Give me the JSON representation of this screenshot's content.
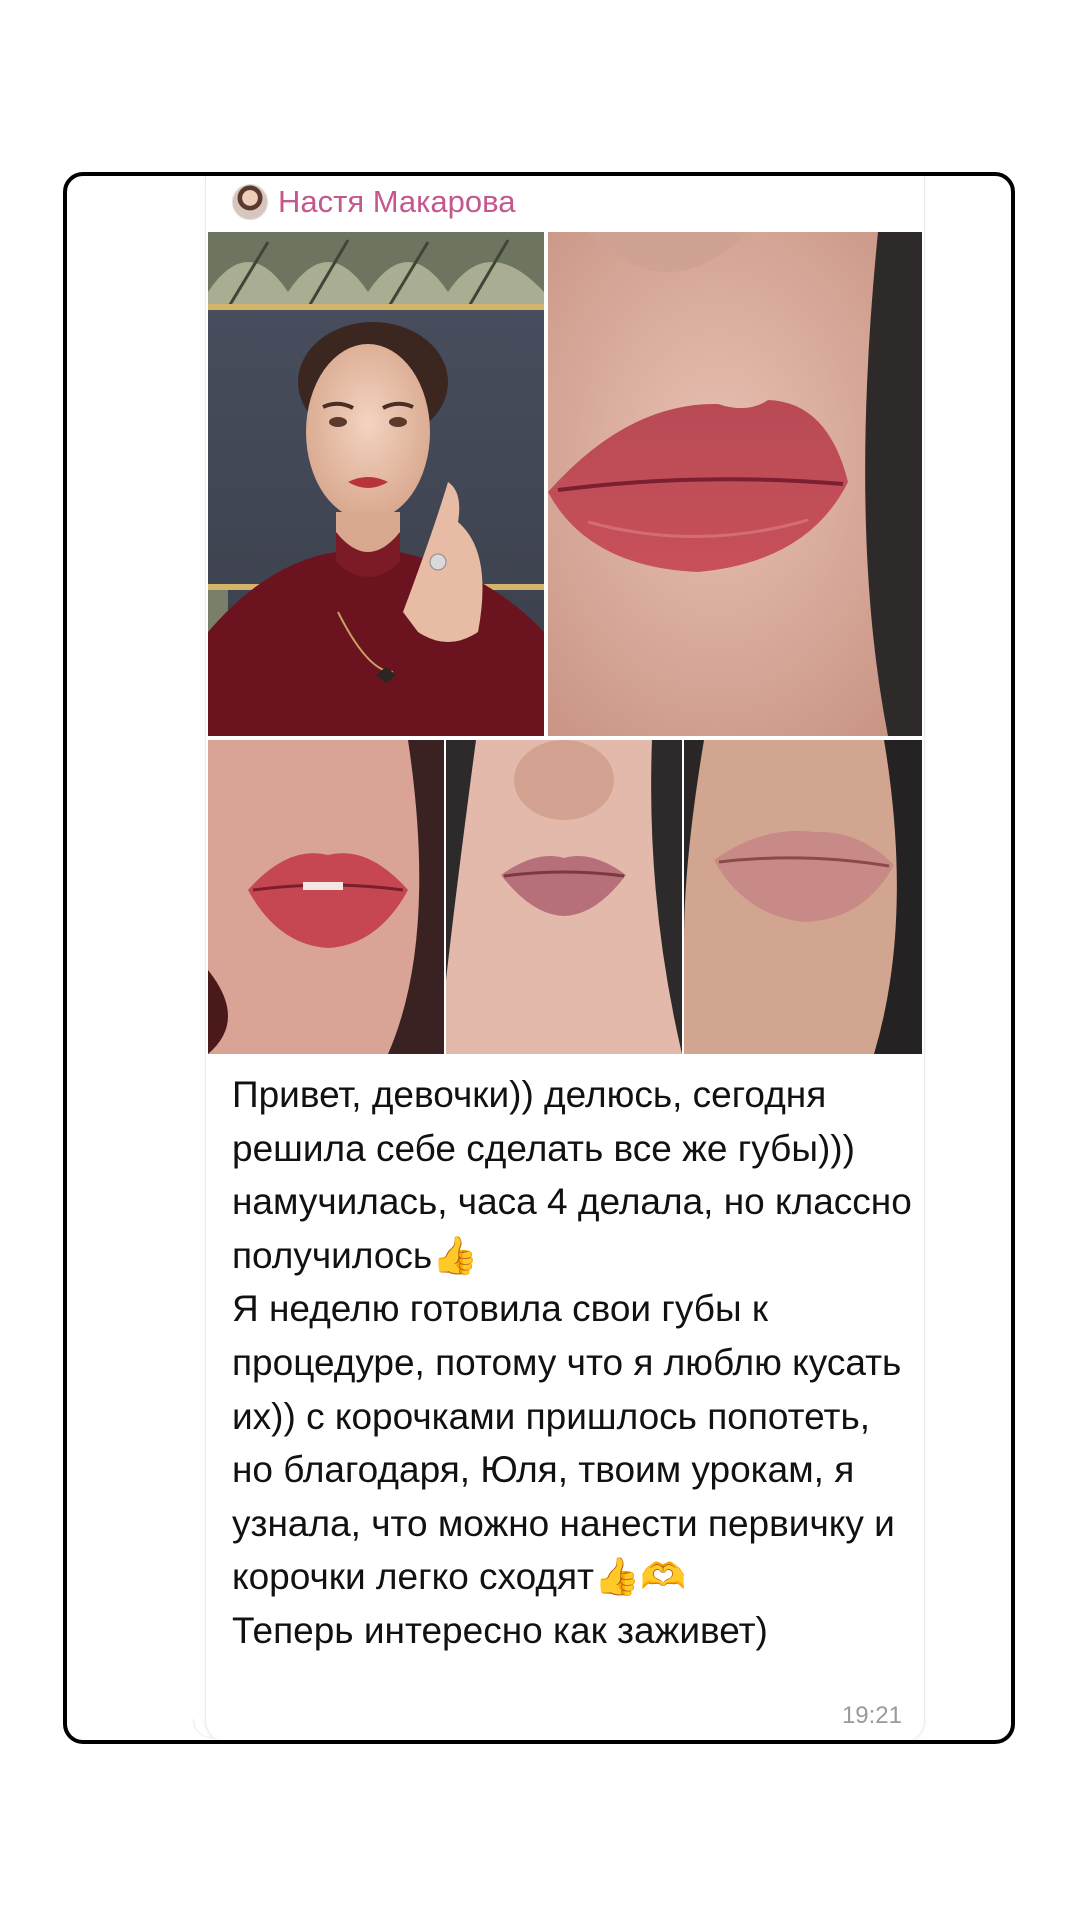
{
  "message": {
    "sender_name": "Настя Макарова",
    "avatar_icon": "user-avatar-photo",
    "text": "Привет, девочки)) делюсь, сегодня решила себе сделать все же губы))) намучилась, часа 4 делала, но классно получилось👍\nЯ неделю готовила свои губы к процедуре, потому что я люблю кусать их)) с корочками пришлось попотеть, но благодаря, Юля, твоим урокам, я узнала, что можно нанести первичку и корочки легко сходят👍🫶\nТеперь интересно как заживет)",
    "time": "19:21",
    "photos": [
      "portrait-photo",
      "lips-closeup-photo",
      "lips-front-photo",
      "lips-nose-photo",
      "lips-side-photo"
    ]
  },
  "colors": {
    "sender_name": "#c4588e",
    "frame_border": "#000000",
    "time": "#9a9a9a"
  }
}
